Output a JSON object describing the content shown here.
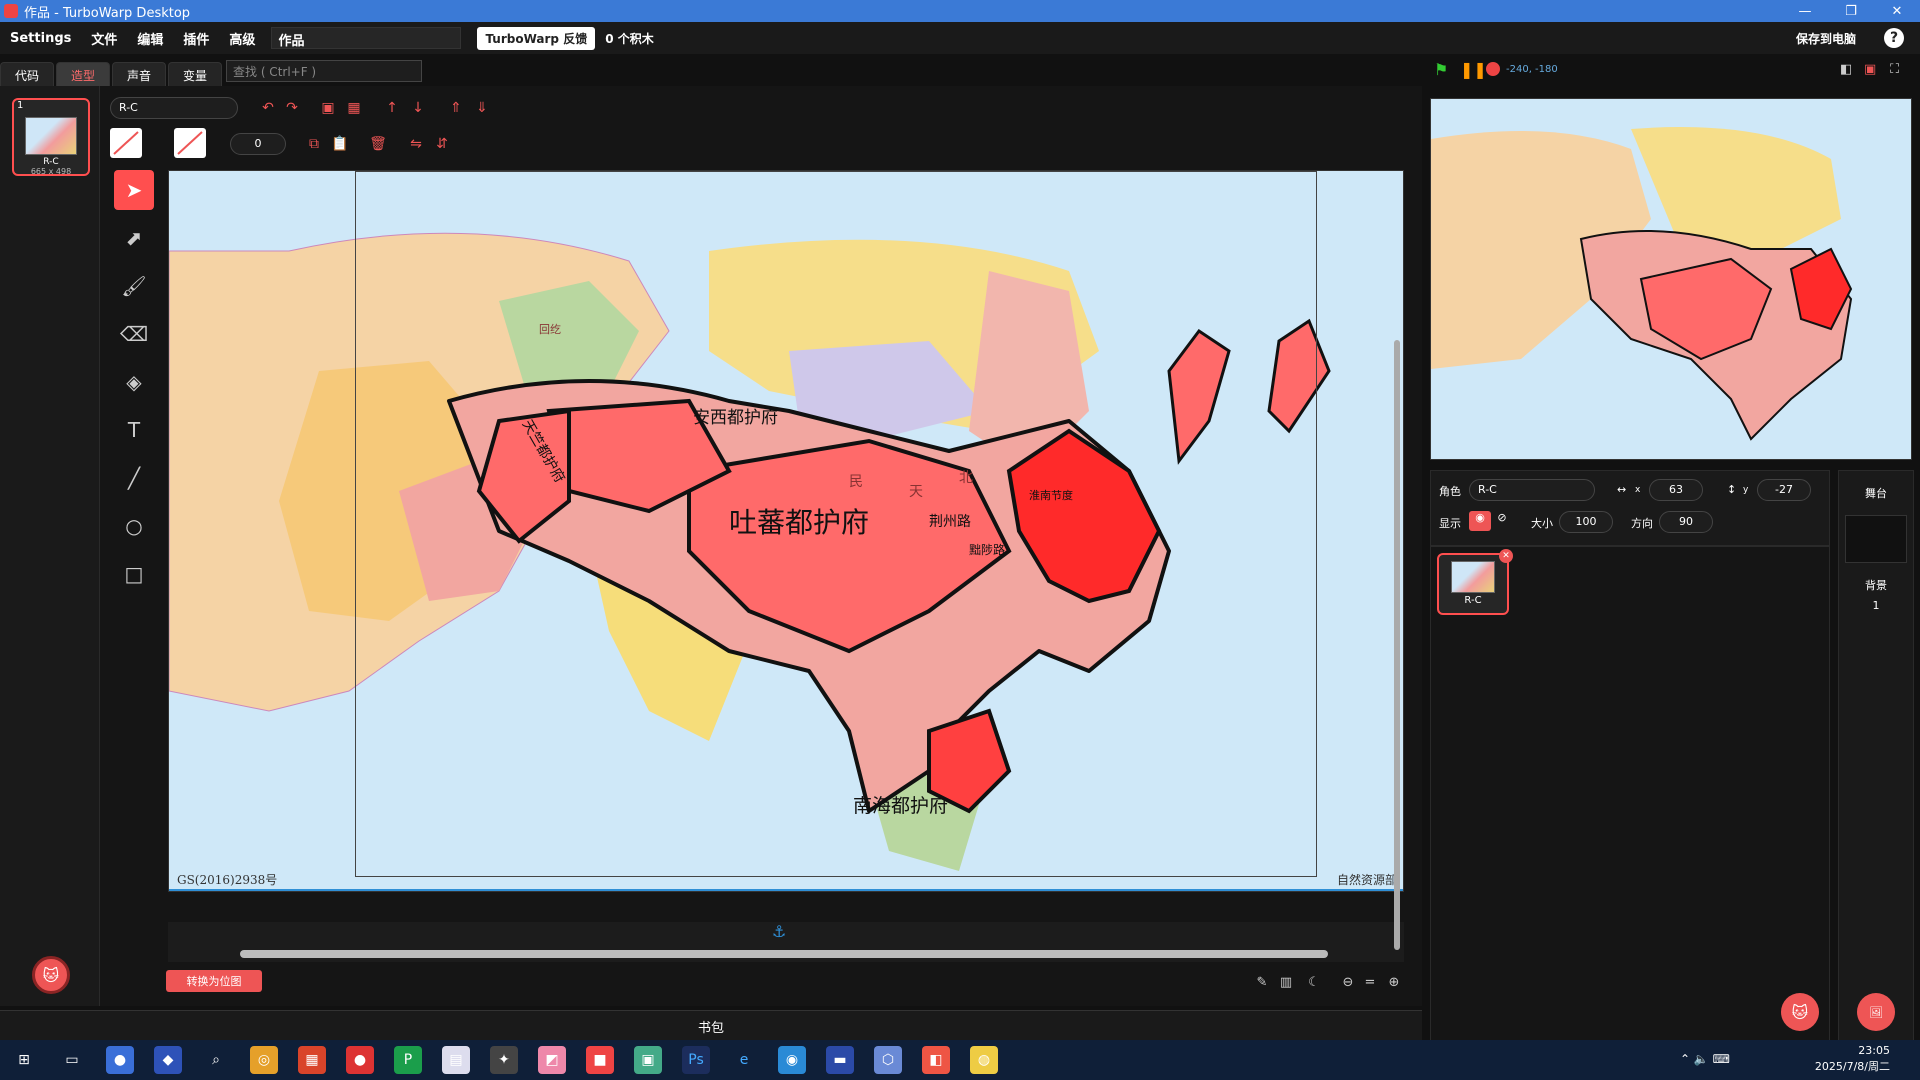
{
  "window": {
    "title": "作品 - TurboWarp Desktop",
    "minimize": "—",
    "restore": "❐",
    "close": "✕"
  },
  "menu": {
    "items": [
      "Settings",
      "文件",
      "编辑",
      "插件",
      "高级"
    ],
    "project_name": "作品",
    "feedback": "TurboWarp 反馈",
    "blocks_count": "0 个积木",
    "save": "保存到电脑",
    "help": "?"
  },
  "tabs": [
    "代码",
    "造型",
    "声音",
    "变量"
  ],
  "find": {
    "placeholder": "查找 ( Ctrl+F )"
  },
  "costume": {
    "index": "1",
    "name": "R-C",
    "size": "665 x 498"
  },
  "editor": {
    "costume_name": "R-C",
    "outline_width": "0",
    "convert": "转换为位图"
  },
  "map": {
    "labels": [
      "安西都护府",
      "天竺都护府",
      "吐蕃都护府",
      "南海都护府",
      "荆州路",
      "黜陟路",
      "淮南节度",
      "回纥",
      "民",
      "天",
      "北"
    ],
    "footer_left": "GS(2016)2938号",
    "footer_right": "自然资源部"
  },
  "stage": {
    "coords": "-240, -180"
  },
  "sprite": {
    "label": "角色",
    "name": "R-C",
    "x_label": "x",
    "x": "63",
    "y_label": "y",
    "y": "-27",
    "show_label": "显示",
    "size_label": "大小",
    "size": "100",
    "direction_label": "方向",
    "direction": "90"
  },
  "stage_pane": {
    "title": "舞台",
    "backdrop_label": "背景",
    "backdrop_count": "1"
  },
  "backpack": "书包",
  "taskbar": {
    "time": "23:05",
    "date": "2025/7/8/周二"
  }
}
